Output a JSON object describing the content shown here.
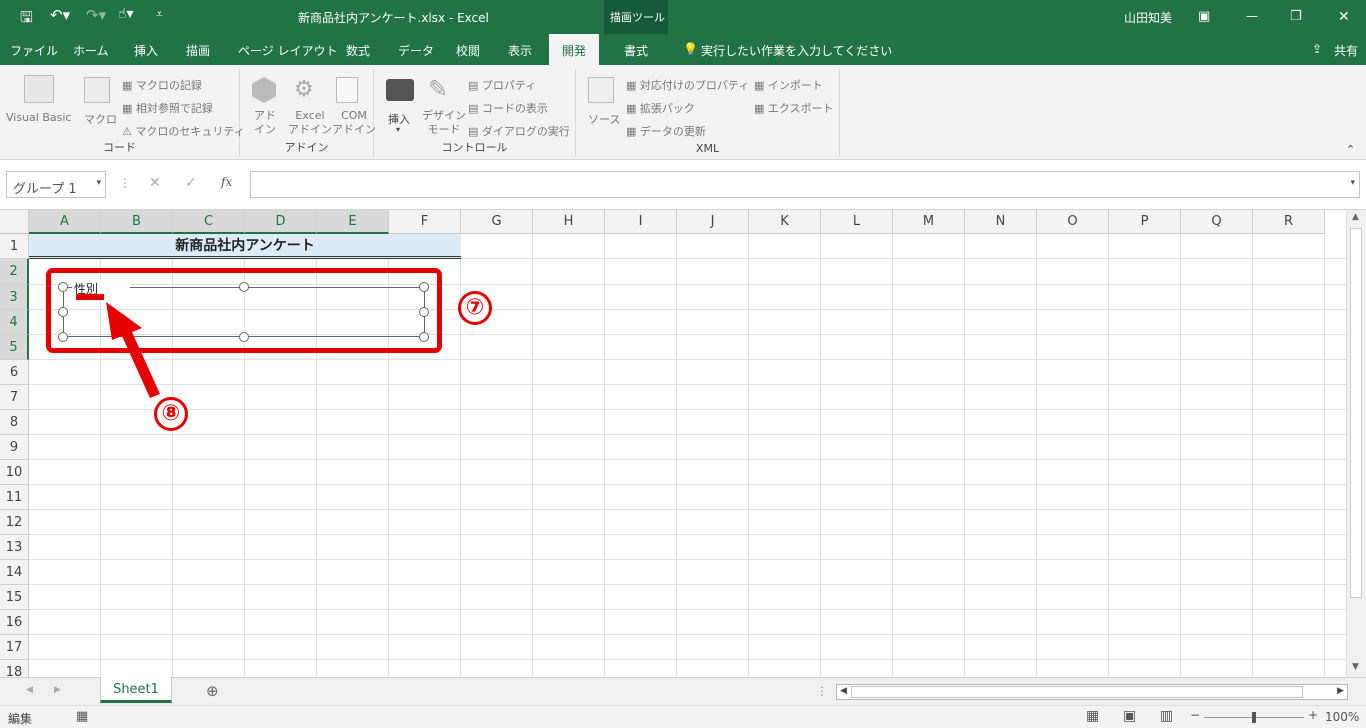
{
  "window": {
    "title": "新商品社内アンケート.xlsx  -  Excel",
    "context_tool": "描画ツール",
    "user": "山田知美",
    "share": "共有"
  },
  "tabs": [
    "ファイル",
    "ホーム",
    "挿入",
    "描画",
    "ページ レイアウト",
    "数式",
    "データ",
    "校閲",
    "表示",
    "開発",
    "書式"
  ],
  "active_tab": "開発",
  "tell_me": "実行したい作業を入力してください",
  "ribbon": {
    "code": {
      "label": "コード",
      "visual_basic": "Visual Basic",
      "macro": "マクロ",
      "record": "マクロの記録",
      "relative": "相対参照で記録",
      "security": "マクロのセキュリティ"
    },
    "addins": {
      "label": "アドイン",
      "addin": "アド\nイン",
      "excel_addin": "Excel\nアドイン",
      "com_addin": "COM\nアドイン"
    },
    "controls": {
      "label": "コントロール",
      "insert": "挿入",
      "design_mode": "デザイン\nモード",
      "properties": "プロパティ",
      "view_code": "コードの表示",
      "run_dialog": "ダイアログの実行"
    },
    "xml": {
      "label": "XML",
      "source": "ソース",
      "map_props": "対応付けのプロパティ",
      "expansion": "拡張パック",
      "refresh": "データの更新",
      "import": "インポート",
      "export": "エクスポート"
    }
  },
  "formula_bar": {
    "name_box": "グループ 1",
    "fx": "fx",
    "value": ""
  },
  "columns": [
    "A",
    "B",
    "C",
    "D",
    "E",
    "F",
    "G",
    "H",
    "I",
    "J",
    "K",
    "L",
    "M",
    "N",
    "O",
    "P",
    "Q",
    "R"
  ],
  "selected_columns": [
    "A",
    "B",
    "C",
    "D",
    "E"
  ],
  "rows": [
    "1",
    "2",
    "3",
    "4",
    "5",
    "6",
    "7",
    "8",
    "9",
    "10",
    "11",
    "12",
    "13",
    "14",
    "15",
    "16",
    "17",
    "18"
  ],
  "selected_rows": [
    "2",
    "3",
    "4",
    "5"
  ],
  "cells": {
    "A1_title": "新商品社内アンケート"
  },
  "group_box": {
    "caption": "性別"
  },
  "callouts": {
    "seven": "⑦",
    "eight": "⑧"
  },
  "sheets": [
    "Sheet1"
  ],
  "status": {
    "mode": "編集",
    "zoom": "100%"
  },
  "colors": {
    "accent": "#217346",
    "annotation": "#e40000",
    "title_fill": "#ddebf7"
  }
}
